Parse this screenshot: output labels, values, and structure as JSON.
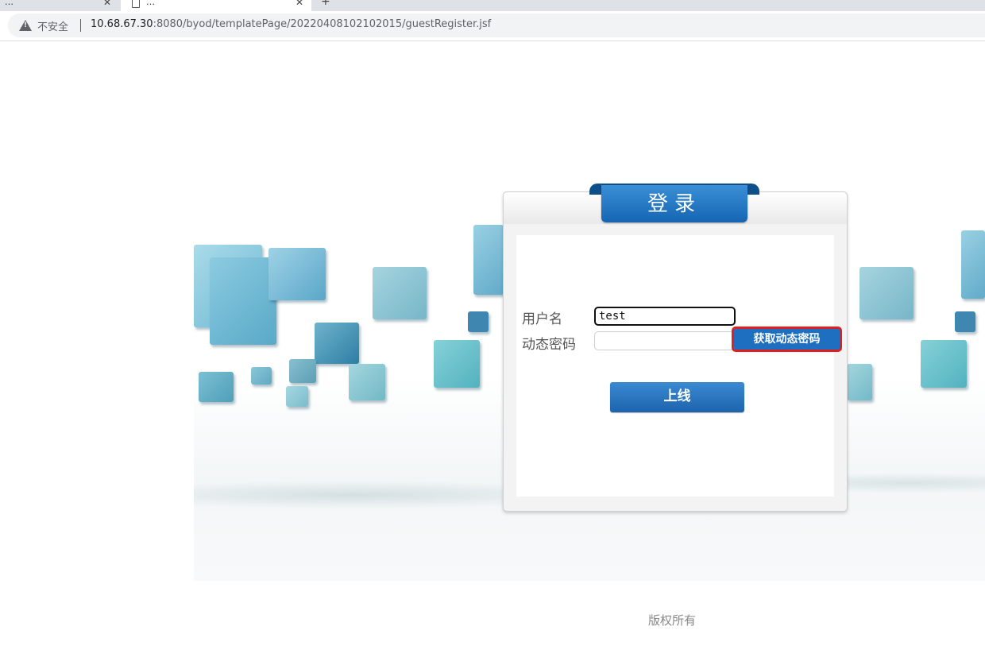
{
  "browser": {
    "tabs": [
      {
        "title": "…"
      },
      {
        "title": "…"
      }
    ],
    "security_label": "不安全",
    "url_host": "10.68.67.30",
    "url_rest": ":8080/byod/templatePage/20220408102102015/guestRegister.jsf"
  },
  "login": {
    "title": "登录",
    "username_label": "用户名",
    "username_value": "test",
    "otp_label": "动态密码",
    "otp_value": "",
    "get_otp_label": "获取动态密码",
    "submit_label": "上线"
  },
  "footer": {
    "text": "版权所有"
  },
  "colors": {
    "accent": "#1f6fc0",
    "highlight": "#e02020",
    "cube_blue": "#6fb8d3"
  }
}
